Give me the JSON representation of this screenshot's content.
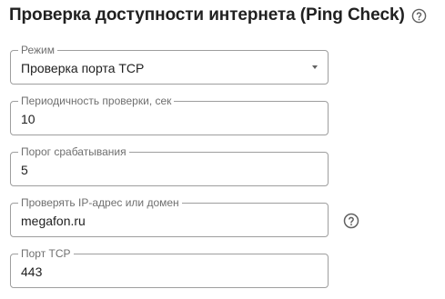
{
  "header": {
    "title": "Проверка доступности интернета (Ping Check)",
    "help_icon": "help-circle-icon"
  },
  "form": {
    "mode": {
      "label": "Режим",
      "value": "Проверка порта TCP",
      "control": "select",
      "arrow_icon": "dropdown-arrow-icon"
    },
    "interval": {
      "label": "Периодичность проверки, сек",
      "value": "10"
    },
    "threshold": {
      "label": "Порог срабатывания",
      "value": "5"
    },
    "host": {
      "label": "Проверять IP-адрес или домен",
      "value": "megafon.ru",
      "help_icon": "help-circle-icon"
    },
    "port": {
      "label": "Порт TCP",
      "value": "443"
    }
  },
  "colors": {
    "border": "#9e9e9e",
    "label": "#6f6f6f",
    "text": "#212121",
    "icon": "#616161"
  }
}
